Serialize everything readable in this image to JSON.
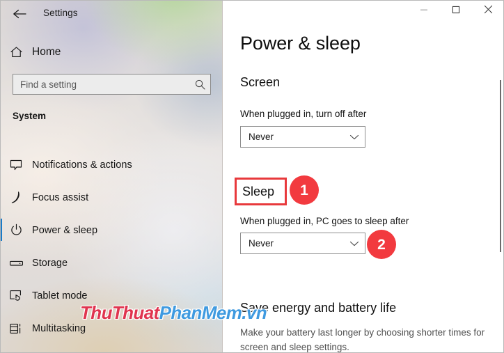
{
  "window": {
    "title": "Settings",
    "back_icon": "back-arrow-icon",
    "controls": [
      {
        "name": "minimize",
        "glyph": "minimize-icon"
      },
      {
        "name": "maximize",
        "glyph": "maximize-icon"
      },
      {
        "name": "close",
        "glyph": "close-icon"
      }
    ]
  },
  "sidebar": {
    "home_label": "Home",
    "home_icon": "home-icon",
    "search": {
      "placeholder": "Find a setting",
      "value": "",
      "icon": "search-icon"
    },
    "section_label": "System",
    "items": [
      {
        "label": "Notifications & actions",
        "icon": "notification-bubble-icon",
        "selected": false
      },
      {
        "label": "Focus assist",
        "icon": "moon-icon",
        "selected": false
      },
      {
        "label": "Power & sleep",
        "icon": "power-icon",
        "selected": true
      },
      {
        "label": "Storage",
        "icon": "storage-drive-icon",
        "selected": false
      },
      {
        "label": "Tablet mode",
        "icon": "tablet-hand-icon",
        "selected": false
      },
      {
        "label": "Multitasking",
        "icon": "multitasking-panes-icon",
        "selected": false
      }
    ]
  },
  "main": {
    "page_title": "Power & sleep",
    "screen": {
      "heading": "Screen",
      "field_label": "When plugged in, turn off after",
      "dropdown_value": "Never",
      "dropdown_icon": "chevron-down-icon"
    },
    "sleep": {
      "heading": "Sleep",
      "field_label": "When plugged in, PC goes to sleep after",
      "dropdown_value": "Never",
      "dropdown_icon": "chevron-down-icon"
    },
    "save_energy": {
      "heading": "Save energy and battery life",
      "description": "Make your battery last longer by choosing shorter times for screen and sleep settings."
    }
  },
  "annotations": {
    "callouts": [
      {
        "number": "1",
        "target": "sleep-heading"
      },
      {
        "number": "2",
        "target": "sleep-dropdown"
      }
    ],
    "highlight_color": "#e8393c",
    "callout_color": "#f23a3f"
  },
  "watermark": {
    "part_red": "ThuThuat",
    "part_blue": "PhanMem.vn",
    "color_red": "#e0344f",
    "color_blue": "#3f9ae0"
  },
  "theme": {
    "accent": "#1a7bc7",
    "content_bg": "#ffffff"
  }
}
